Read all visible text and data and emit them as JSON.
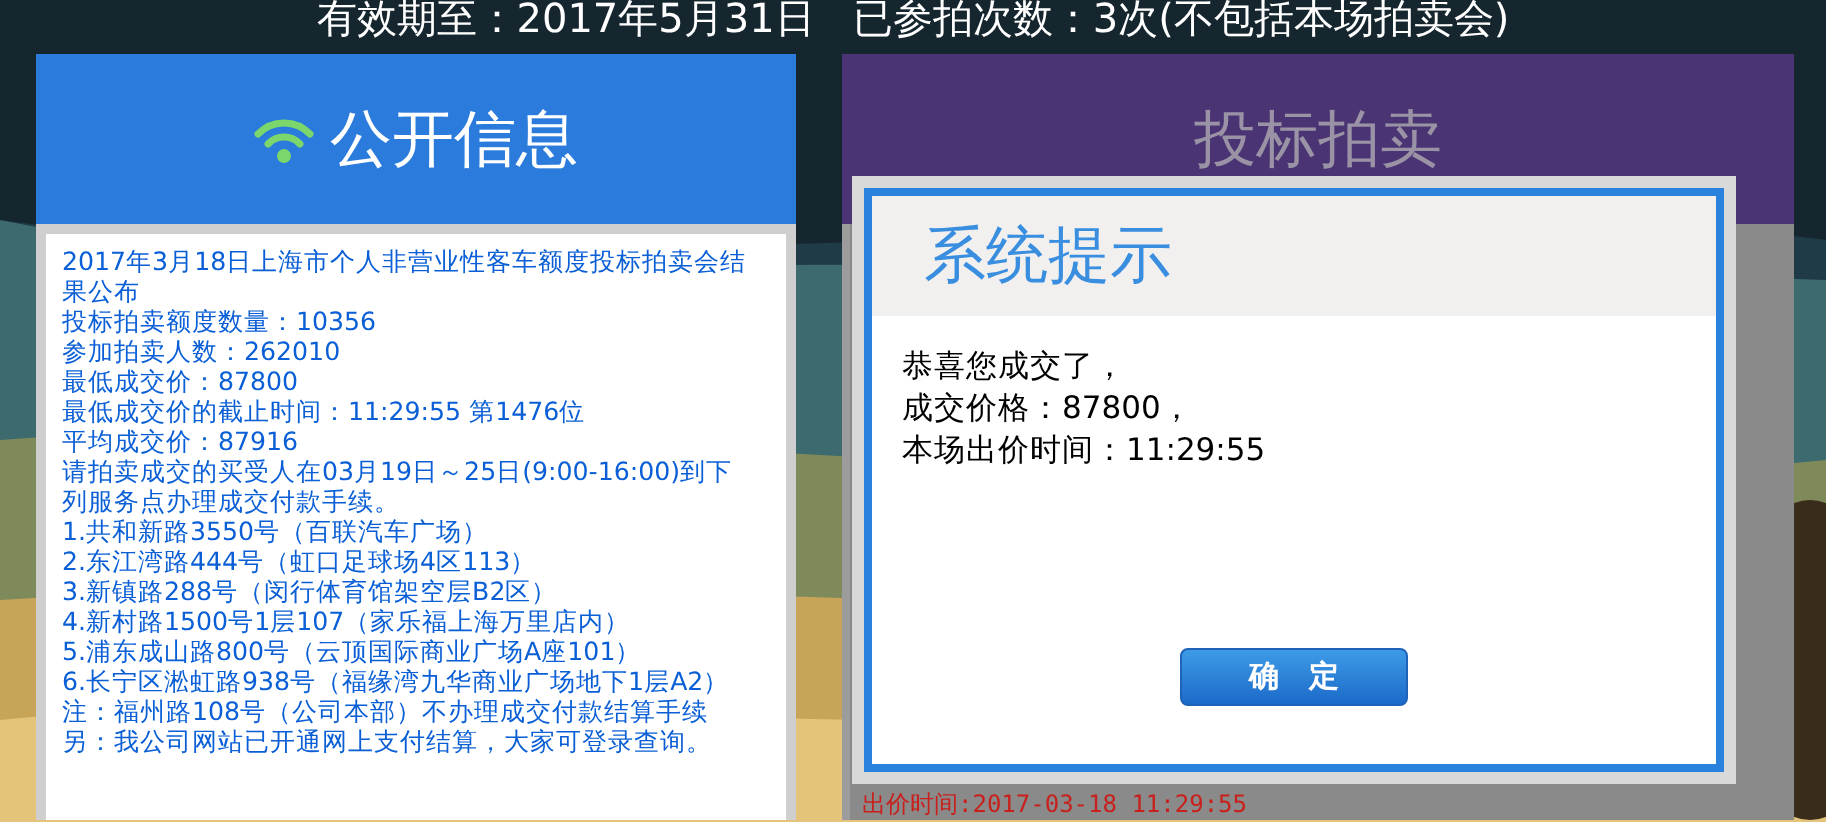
{
  "top_banner": "有效期至：2017年5月31日   已参拍次数：3次(不包括本场拍卖会)",
  "public_info": {
    "title": "公开信息",
    "lines": [
      "2017年3月18日上海市个人非营业性客车额度投标拍卖会结果公布",
      "投标拍卖额度数量：10356",
      "参加拍卖人数：262010",
      "最低成交价：87800",
      "最低成交价的截止时间：11:29:55 第1476位",
      "平均成交价：87916",
      "请拍卖成交的买受人在03月19日～25日(9:00-16:00)到下列服务点办理成交付款手续。",
      "1.共和新路3550号（百联汽车广场）",
      "2.东江湾路444号（虹口足球场4区113）",
      "3.新镇路288号（闵行体育馆架空层B2区）",
      "4.新村路1500号1层107（家乐福上海万里店内）",
      "5.浦东成山路800号（云顶国际商业广场A座101）",
      "6.长宁区淞虹路938号（福缘湾九华商业广场地下1层A2）",
      "注：福州路108号（公司本部）不办理成交付款结算手续",
      "另：我公司网站已开通网上支付结算，大家可登录查询。"
    ]
  },
  "bidding": {
    "title": "投标拍卖",
    "bid_time": "出价时间:2017-03-18 11:29:55"
  },
  "dialog": {
    "title": "系统提示",
    "lines": [
      "恭喜您成交了，",
      "成交价格：87800，",
      "本场出价时间：11:29:55"
    ],
    "button": "确　定"
  }
}
